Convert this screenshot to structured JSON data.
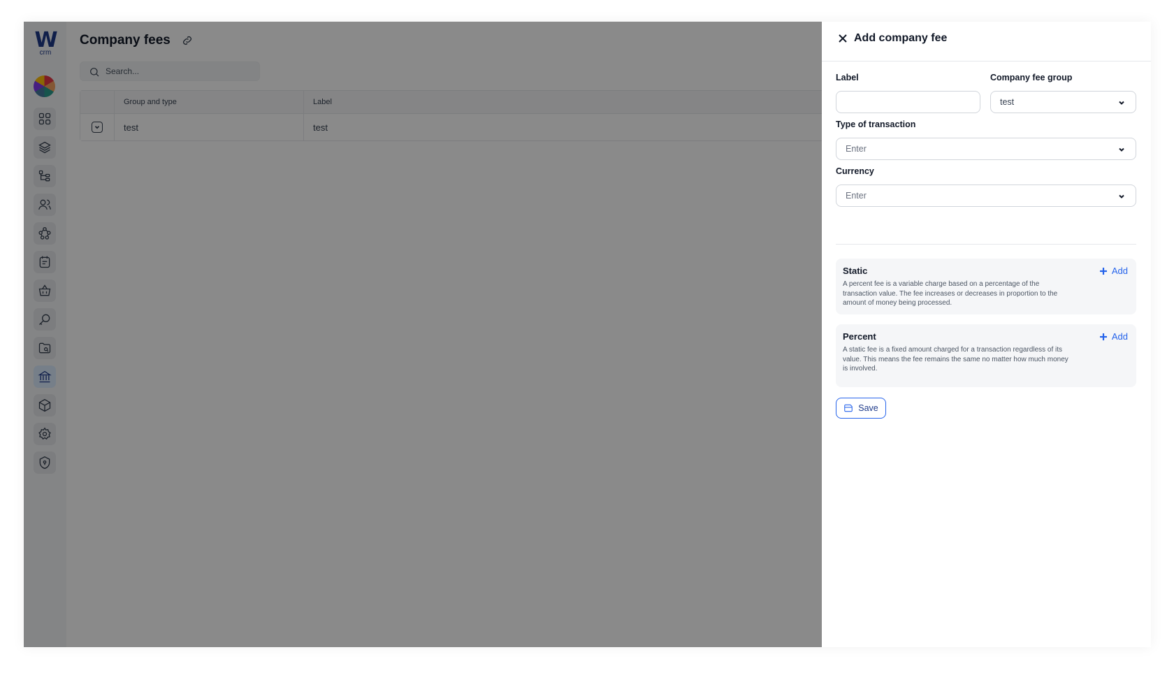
{
  "app": {
    "logo_text": "W",
    "logo_sub": "crm"
  },
  "sidebar": {
    "items": [
      {
        "name": "dashboard-icon"
      },
      {
        "name": "layers-icon"
      },
      {
        "name": "hierarchy-icon"
      },
      {
        "name": "users-icon"
      },
      {
        "name": "network-icon"
      },
      {
        "name": "notes-icon"
      },
      {
        "name": "basket-icon"
      },
      {
        "name": "key-search-icon"
      },
      {
        "name": "folder-search-icon"
      },
      {
        "name": "bank-icon",
        "active": true
      },
      {
        "name": "box-icon"
      },
      {
        "name": "settings-icon"
      },
      {
        "name": "shield-icon"
      }
    ]
  },
  "main": {
    "title": "Company fees",
    "search": {
      "placeholder": "Search...",
      "value": ""
    },
    "table": {
      "columns": [
        "Group and type",
        "Label"
      ],
      "rows": [
        {
          "group_and_type": "test",
          "label": "test"
        }
      ]
    }
  },
  "drawer": {
    "title": "Add company fee",
    "fields": {
      "label": {
        "label": "Label",
        "value": ""
      },
      "company_fee_group": {
        "label": "Company fee group",
        "value": "test"
      },
      "type_of_transaction": {
        "label": "Type of transaction",
        "placeholder": "Enter"
      },
      "currency": {
        "label": "Currency",
        "placeholder": "Enter"
      }
    },
    "static": {
      "title": "Static",
      "description": "A percent fee is a variable charge based on a percentage of the transaction value. The fee increases or decreases in proportion to the amount of money being processed.",
      "add_label": "Add"
    },
    "percent": {
      "title": "Percent",
      "description": "A static fee is a fixed amount charged for a transaction regardless of its value. This means the fee remains the same no matter how much money is involved.",
      "add_label": "Add"
    },
    "save_label": "Save"
  },
  "colors": {
    "accent": "#2563eb",
    "brand": "#1e3a8a",
    "overlay": "rgba(0,0,0,0.46)"
  }
}
